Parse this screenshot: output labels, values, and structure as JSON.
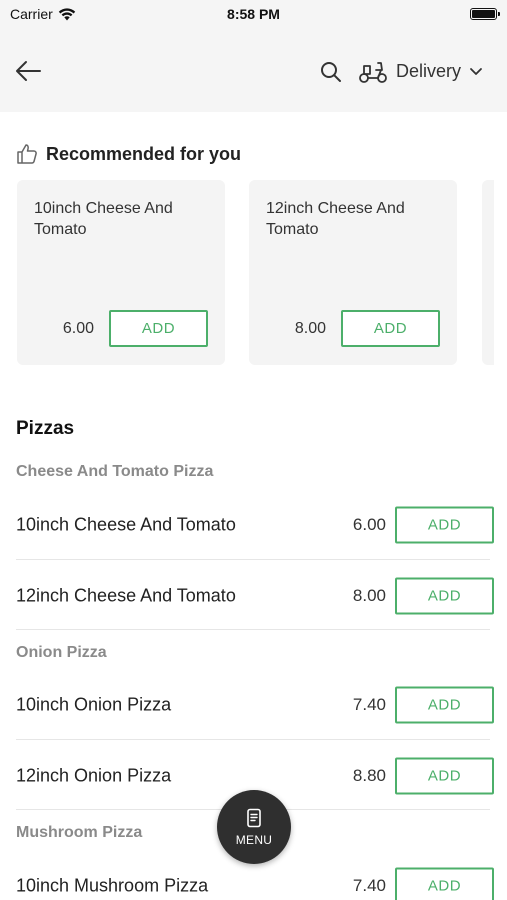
{
  "status_bar": {
    "carrier": "Carrier",
    "time": "8:58 PM"
  },
  "header": {
    "delivery_label": "Delivery"
  },
  "recommended": {
    "title": "Recommended for you",
    "cards": [
      {
        "name": "10inch Cheese And Tomato",
        "price": "6.00",
        "add_label": "ADD"
      },
      {
        "name": "12inch Cheese And Tomato",
        "price": "8.00",
        "add_label": "ADD"
      }
    ]
  },
  "menu": {
    "section_title": "Pizzas",
    "categories": [
      {
        "name": "Cheese And Tomato Pizza",
        "items": [
          {
            "name": "10inch Cheese And Tomato",
            "price": "6.00",
            "add_label": "ADD"
          },
          {
            "name": "12inch Cheese And Tomato",
            "price": "8.00",
            "add_label": "ADD"
          }
        ]
      },
      {
        "name": "Onion Pizza",
        "items": [
          {
            "name": "10inch Onion Pizza",
            "price": "7.40",
            "add_label": "ADD"
          },
          {
            "name": "12inch Onion Pizza",
            "price": "8.80",
            "add_label": "ADD"
          }
        ]
      },
      {
        "name": "Mushroom Pizza",
        "items": [
          {
            "name": "10inch Mushroom Pizza",
            "price": "7.40",
            "add_label": "ADD"
          }
        ]
      }
    ]
  },
  "fab": {
    "label": "MENU"
  },
  "colors": {
    "accent": "#4caf6a",
    "header_bg": "#f5f5f5",
    "card_bg": "#f4f4f4",
    "fab_bg": "#2f2f2f"
  }
}
